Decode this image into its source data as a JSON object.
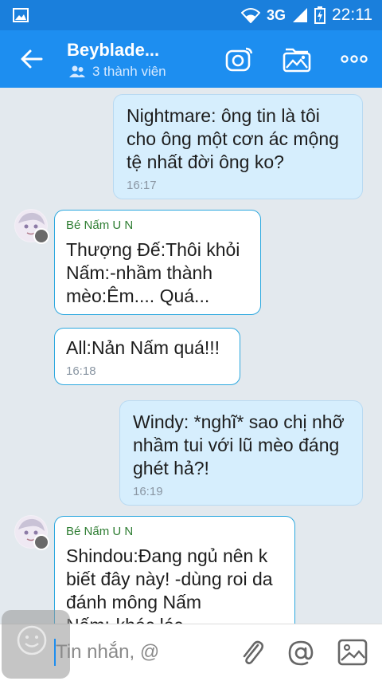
{
  "status_bar": {
    "network": "3G",
    "time": "22:11"
  },
  "header": {
    "title": "Beyblade...",
    "members": "3 thành viên"
  },
  "messages": [
    {
      "side": "out",
      "text": "Nightmare: ông tin là tôi\ncho ông một cơn ác mộng\ntệ nhất đời ông ko?",
      "time": "16:17"
    },
    {
      "side": "in",
      "sender": "Bé Nấm U N",
      "text": "Thượng Đế:Thôi khỏi\nNấm:-nhầm thành\nmèo:Êm.... Quá..."
    },
    {
      "side": "in",
      "text": "All:Nản Nấm quá!!!",
      "time": "16:18"
    },
    {
      "side": "out",
      "text": "Windy: *nghĩ* sao chị nhỡ\nnhầm tui với lũ mèo đáng\nghét hả?!",
      "time": "16:19"
    },
    {
      "side": "in",
      "sender": "Bé Nấm U N",
      "text": "Shindou:Đang ngủ nên k\nbiết đây này! -dùng roi da\nđánh mông Nấm\nNấm:-khóc lóc..."
    }
  ],
  "composer": {
    "placeholder": "Tin nhắn, @"
  },
  "colors": {
    "appbar": "#1d8ef0",
    "statusbar": "#1a7fdc",
    "outgoing_bubble": "#d6eefd",
    "incoming_border": "#2ca8df",
    "sender_name": "#2e7d32"
  }
}
